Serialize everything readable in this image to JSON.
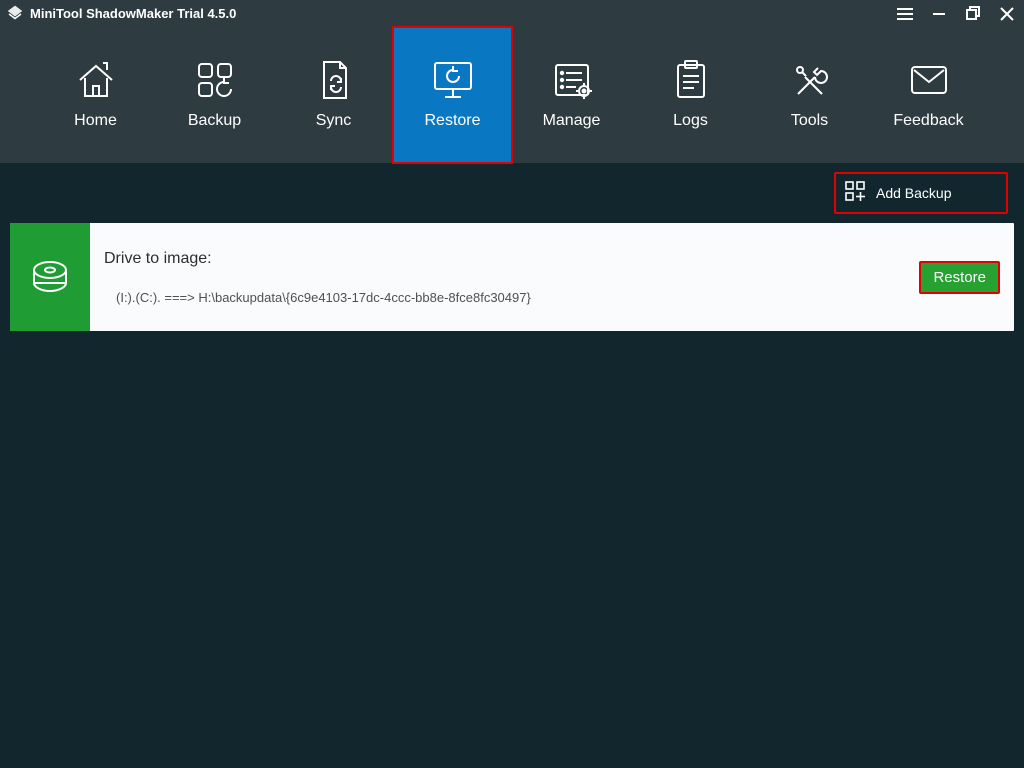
{
  "app": {
    "title": "MiniTool ShadowMaker Trial 4.5.0"
  },
  "nav": {
    "items": [
      {
        "label": "Home"
      },
      {
        "label": "Backup"
      },
      {
        "label": "Sync"
      },
      {
        "label": "Restore"
      },
      {
        "label": "Manage"
      },
      {
        "label": "Logs"
      },
      {
        "label": "Tools"
      },
      {
        "label": "Feedback"
      }
    ],
    "active_index": 3
  },
  "toolbar": {
    "add_backup_label": "Add Backup"
  },
  "entry": {
    "title": "Drive to image:",
    "path": "(I:).(C:). ===> H:\\backupdata\\{6c9e4103-17dc-4ccc-bb8e-8fce8fc30497}",
    "restore_label": "Restore"
  }
}
